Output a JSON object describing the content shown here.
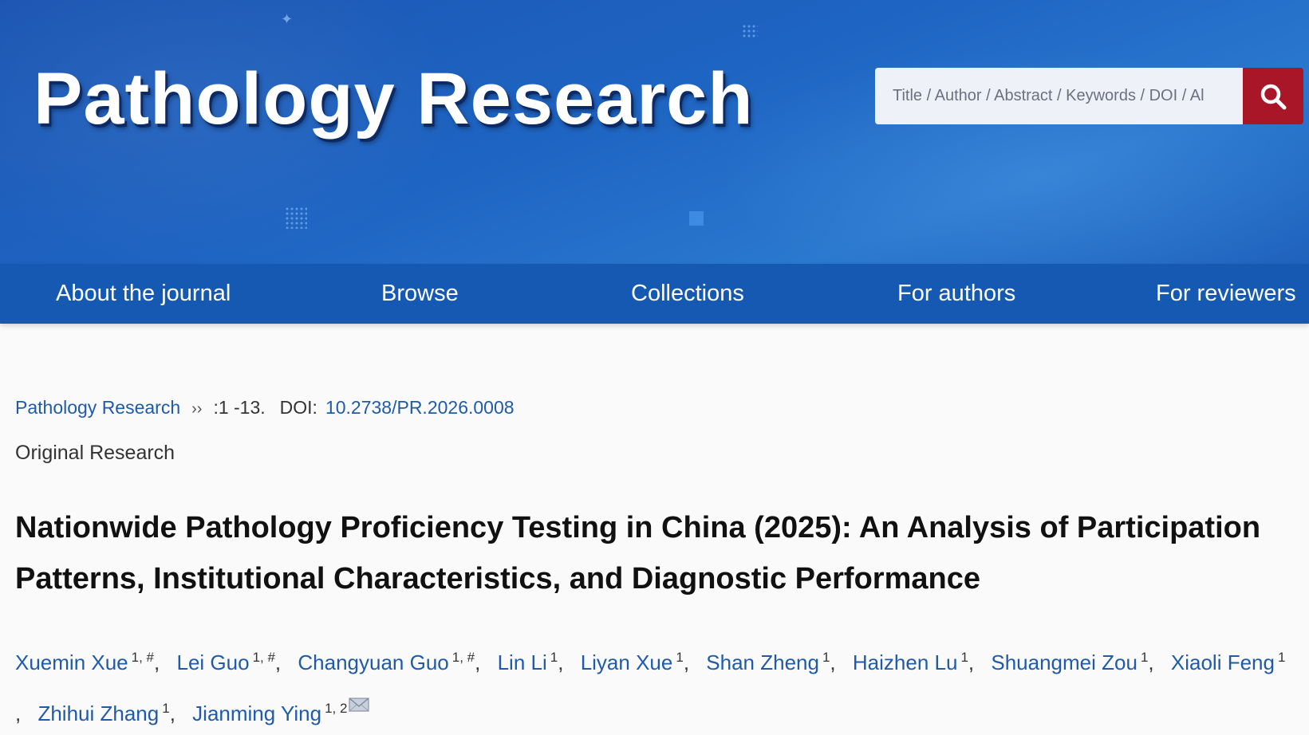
{
  "header": {
    "site_title": "Pathology Research",
    "search": {
      "placeholder": "Title / Author / Abstract / Keywords / DOI / Al",
      "button_icon": "search-icon"
    },
    "colors": {
      "banner": "#1e64c2",
      "nav": "#1559b3",
      "search_button": "#a91628",
      "link": "#1f5ba8"
    }
  },
  "nav": {
    "items": [
      {
        "label": "About the journal"
      },
      {
        "label": "Browse"
      },
      {
        "label": "Collections"
      },
      {
        "label": "For authors"
      },
      {
        "label": "For reviewers"
      }
    ]
  },
  "article": {
    "journal_link": "Pathology Research",
    "separator": "››",
    "pages": ":1 -13.",
    "doi_label": "DOI:",
    "doi": "10.2738/PR.2026.0008",
    "type": "Original Research",
    "title": "Nationwide Pathology Proficiency Testing in China (2025): An Analysis of Participation Patterns, Institutional Characteristics, and Diagnostic Performance",
    "authors": [
      {
        "name": "Xuemin Xue",
        "affil": "1, #"
      },
      {
        "name": "Lei Guo",
        "affil": "1, #"
      },
      {
        "name": "Changyuan Guo",
        "affil": "1, #"
      },
      {
        "name": "Lin Li",
        "affil": "1"
      },
      {
        "name": "Liyan Xue",
        "affil": "1"
      },
      {
        "name": "Shan Zheng",
        "affil": "1"
      },
      {
        "name": "Haizhen Lu",
        "affil": "1"
      },
      {
        "name": "Shuangmei Zou",
        "affil": "1"
      },
      {
        "name": "Xiaoli Feng",
        "affil": "1"
      },
      {
        "name": "Zhihui Zhang",
        "affil": "1"
      },
      {
        "name": "Jianming Ying",
        "affil": "1, 2",
        "corresponding_icon": "mail-icon"
      }
    ]
  }
}
